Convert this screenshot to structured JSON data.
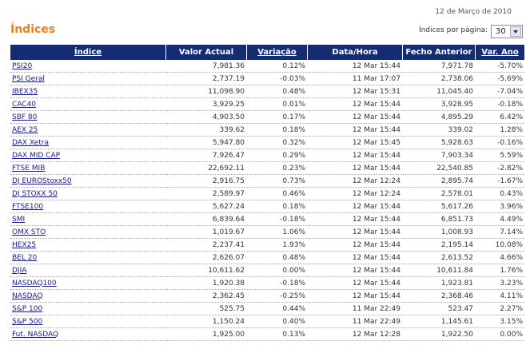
{
  "header": {
    "date": "12 de Março de 2010",
    "title": "Índices",
    "per_page_label": "Índices por página:",
    "per_page_value": "30"
  },
  "columns": [
    "Índice",
    "Valor Actual",
    "Variação",
    "Data/Hora",
    "Fecho Anterior",
    "Var. Ano"
  ],
  "rows": [
    {
      "index": "PSI20",
      "value": "7,981.36",
      "change": "0.12%",
      "datetime": "12 Mar 15:44",
      "prev_close": "7,971.78",
      "ytd": "-5.70%"
    },
    {
      "index": "PSI Geral",
      "value": "2,737.19",
      "change": "-0.03%",
      "datetime": "11 Mar 17:07",
      "prev_close": "2,738.06",
      "ytd": "-5.69%"
    },
    {
      "index": "IBEX35",
      "value": "11,098.90",
      "change": "0.48%",
      "datetime": "12 Mar 15:31",
      "prev_close": "11,045.40",
      "ytd": "-7.04%"
    },
    {
      "index": "CAC40",
      "value": "3,929.25",
      "change": "0.01%",
      "datetime": "12 Mar 15:44",
      "prev_close": "3,928.95",
      "ytd": "-0.18%"
    },
    {
      "index": "SBF 80",
      "value": "4,903.50",
      "change": "0.17%",
      "datetime": "12 Mar 15:44",
      "prev_close": "4,895.29",
      "ytd": "6.42%"
    },
    {
      "index": "AEX 25",
      "value": "339.62",
      "change": "0.18%",
      "datetime": "12 Mar 15:44",
      "prev_close": "339.02",
      "ytd": "1.28%"
    },
    {
      "index": "DAX Xetra",
      "value": "5,947.80",
      "change": "0.32%",
      "datetime": "12 Mar 15:45",
      "prev_close": "5,928.63",
      "ytd": "-0.16%"
    },
    {
      "index": "DAX MID CAP",
      "value": "7,926.47",
      "change": "0.29%",
      "datetime": "12 Mar 15:44",
      "prev_close": "7,903.34",
      "ytd": "5.59%"
    },
    {
      "index": "FTSE MIB",
      "value": "22,692.11",
      "change": "0.23%",
      "datetime": "12 Mar 15:44",
      "prev_close": "22,540.85",
      "ytd": "-2.82%"
    },
    {
      "index": "DJ EUROStoxx50",
      "value": "2,916.75",
      "change": "0.73%",
      "datetime": "12 Mar 12:24",
      "prev_close": "2,895.74",
      "ytd": "-1.67%"
    },
    {
      "index": "DJ STOXX 50",
      "value": "2,589.97",
      "change": "0.46%",
      "datetime": "12 Mar 12:24",
      "prev_close": "2,578.01",
      "ytd": "0.43%"
    },
    {
      "index": "FTSE100",
      "value": "5,627.24",
      "change": "0.18%",
      "datetime": "12 Mar 15:44",
      "prev_close": "5,617.26",
      "ytd": "3.96%"
    },
    {
      "index": "SMI",
      "value": "6,839.64",
      "change": "-0.18%",
      "datetime": "12 Mar 15:44",
      "prev_close": "6,851.73",
      "ytd": "4.49%"
    },
    {
      "index": "OMX STO",
      "value": "1,019.67",
      "change": "1.06%",
      "datetime": "12 Mar 15:44",
      "prev_close": "1,008.93",
      "ytd": "7.14%"
    },
    {
      "index": "HEX25",
      "value": "2,237.41",
      "change": "1.93%",
      "datetime": "12 Mar 15:44",
      "prev_close": "2,195.14",
      "ytd": "10.08%"
    },
    {
      "index": "BEL 20",
      "value": "2,626.07",
      "change": "0.48%",
      "datetime": "12 Mar 15:44",
      "prev_close": "2,613.52",
      "ytd": "4.66%"
    },
    {
      "index": "DJIA",
      "value": "10,611.62",
      "change": "0.00%",
      "datetime": "12 Mar 15:44",
      "prev_close": "10,611.84",
      "ytd": "1.76%"
    },
    {
      "index": "NASDAQ100",
      "value": "1,920.38",
      "change": "-0.18%",
      "datetime": "12 Mar 15:44",
      "prev_close": "1,923.81",
      "ytd": "3.23%"
    },
    {
      "index": "NASDAQ",
      "value": "2,362.45",
      "change": "-0.25%",
      "datetime": "12 Mar 15:44",
      "prev_close": "2,368.46",
      "ytd": "4.11%"
    },
    {
      "index": "S&P 100",
      "value": "525.75",
      "change": "0.44%",
      "datetime": "11 Mar 22:49",
      "prev_close": "523.47",
      "ytd": "2.27%"
    },
    {
      "index": "S&P 500",
      "value": "1,150.24",
      "change": "0.40%",
      "datetime": "11 Mar 22:49",
      "prev_close": "1,145.61",
      "ytd": "3.15%"
    },
    {
      "index": "Fut. NASDAQ",
      "value": "1,925.00",
      "change": "0.13%",
      "datetime": "12 Mar 12:28",
      "prev_close": "1,922.50",
      "ytd": "0.00%"
    }
  ],
  "colors": {
    "accent": "#ef7e20",
    "header_bg": "#152c74",
    "link": "#1a1a8c"
  }
}
